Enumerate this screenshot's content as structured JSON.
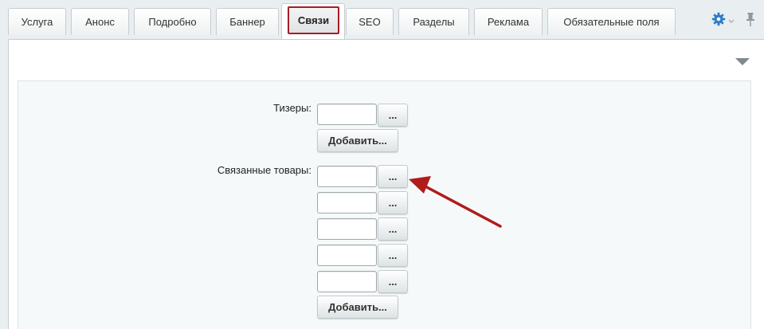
{
  "tabs": [
    {
      "label": "Услуга"
    },
    {
      "label": "Анонс"
    },
    {
      "label": "Подробно"
    },
    {
      "label": "Баннер"
    },
    {
      "label": "Связи",
      "active": true
    },
    {
      "label": "SEO"
    },
    {
      "label": "Разделы"
    },
    {
      "label": "Реклама"
    },
    {
      "label": "Обязательные поля"
    }
  ],
  "toolbar": {
    "settings_icon": "gear-icon",
    "pin_icon": "pin-icon",
    "collapse_icon": "triangle-down-icon"
  },
  "form": {
    "teasers": {
      "label": "Тизеры:",
      "inputs": [
        ""
      ],
      "browse_label": "...",
      "add_label": "Добавить..."
    },
    "related": {
      "label": "Связанные товары:",
      "inputs": [
        "",
        "",
        "",
        "",
        ""
      ],
      "browse_label": "...",
      "add_label": "Добавить..."
    }
  },
  "colors": {
    "active_tab_border": "#a51d24",
    "annotation_arrow": "#b01c1c",
    "gear": "#2f7dc4"
  }
}
